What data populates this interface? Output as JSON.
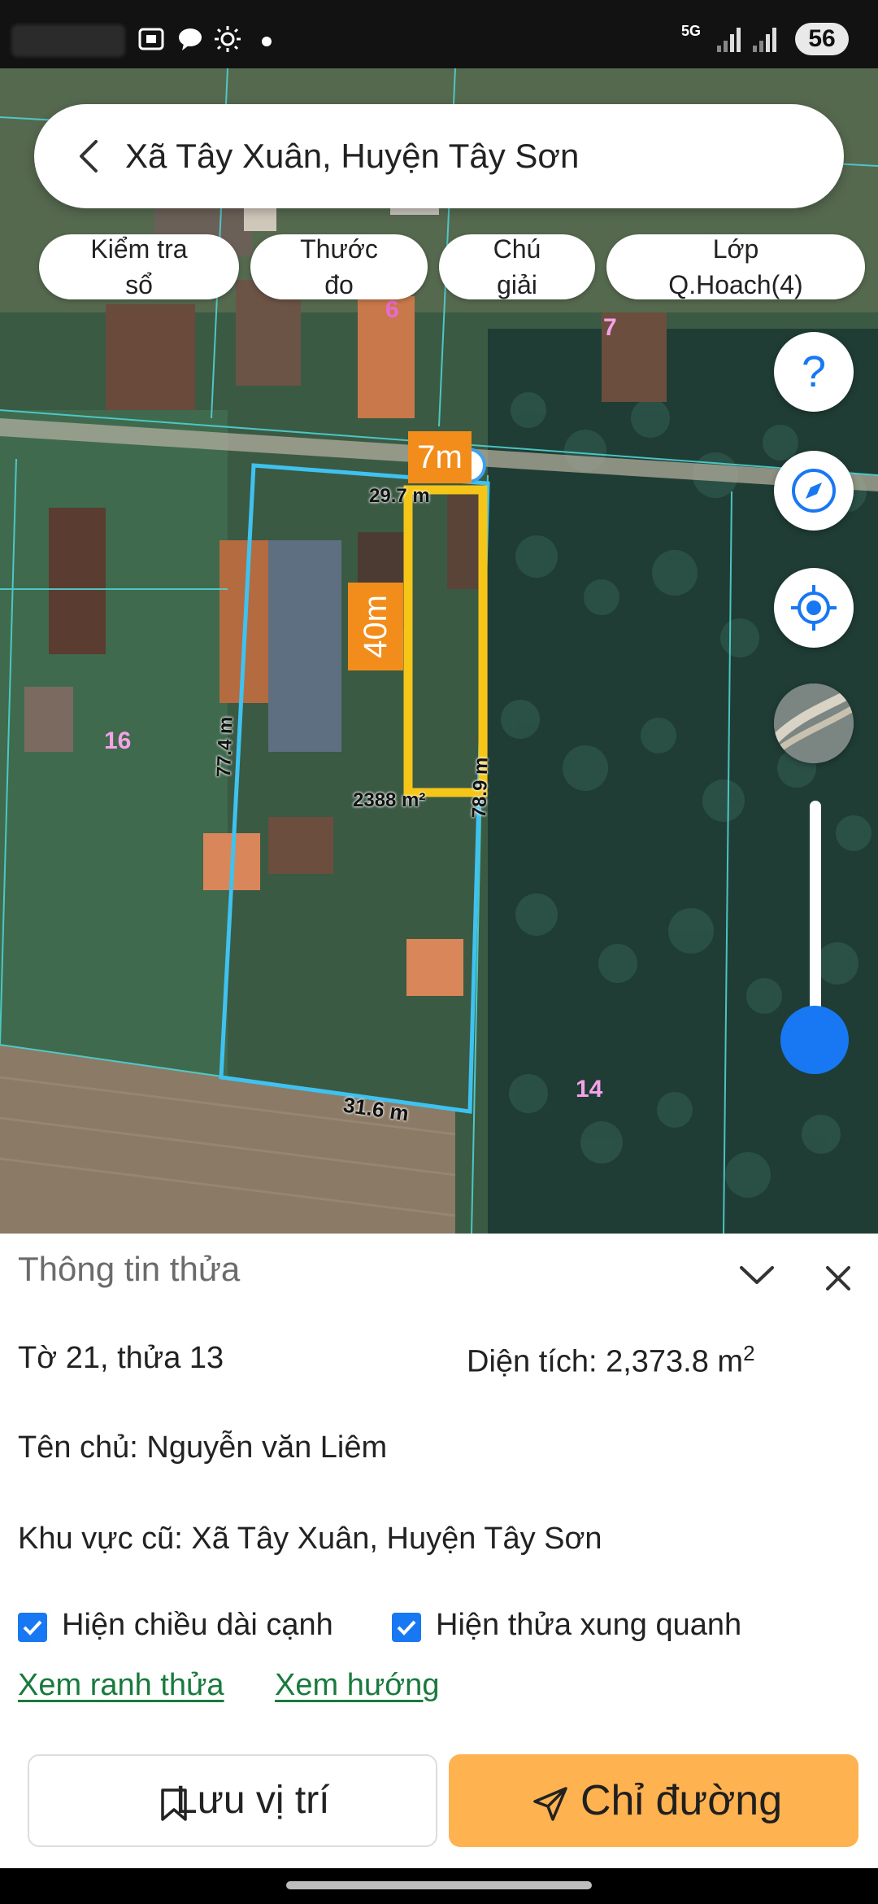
{
  "header": {
    "title": "Xã Tây Xuân, Huyện Tây Sơn"
  },
  "status_bar": {
    "network": "5G",
    "battery": "56"
  },
  "chips": [
    {
      "line1": "Kiểm tra",
      "line2": "sổ"
    },
    {
      "line1": "Thước",
      "line2": "đo"
    },
    {
      "line1": "Chú",
      "line2": "giải"
    },
    {
      "line1": "Lớp",
      "line2": "Q.Hoach(4)"
    }
  ],
  "map": {
    "parcel_numbers": [
      "6",
      "7",
      "16",
      "14"
    ],
    "edge_top": "29.7 m",
    "edge_left": "77.4 m",
    "edge_right": "78.9 m",
    "edge_bottom": "31.6 m",
    "area_label": "2388 m²",
    "overlay_width": "7m",
    "overlay_length": "40m",
    "zoom_level": 0.86
  },
  "sheet": {
    "title": "Thông tin thửa",
    "sheet_parcel": "Tờ 21, thửa 13",
    "area": "Diện tích: 2,373.8 m",
    "area_sup": "2",
    "owner": "Tên chủ: Nguyễn văn Liêm",
    "old_area": "Khu vực cũ: Xã Tây Xuân, Huyện Tây Sơn",
    "check1": "Hiện chiều dài cạnh",
    "check2": "Hiện thửa xung quanh",
    "link1": "Xem ranh thửa",
    "link2": "Xem hướng",
    "save_label": "Lưu vị trí",
    "directions_label": "Chỉ đường"
  },
  "colors": {
    "accent_blue": "#1877f2",
    "button_orange": "#ffb24f",
    "overlay_yellow": "#f5c518",
    "overlay_orange": "#f28c1a",
    "link_green": "#1a7a3d"
  }
}
